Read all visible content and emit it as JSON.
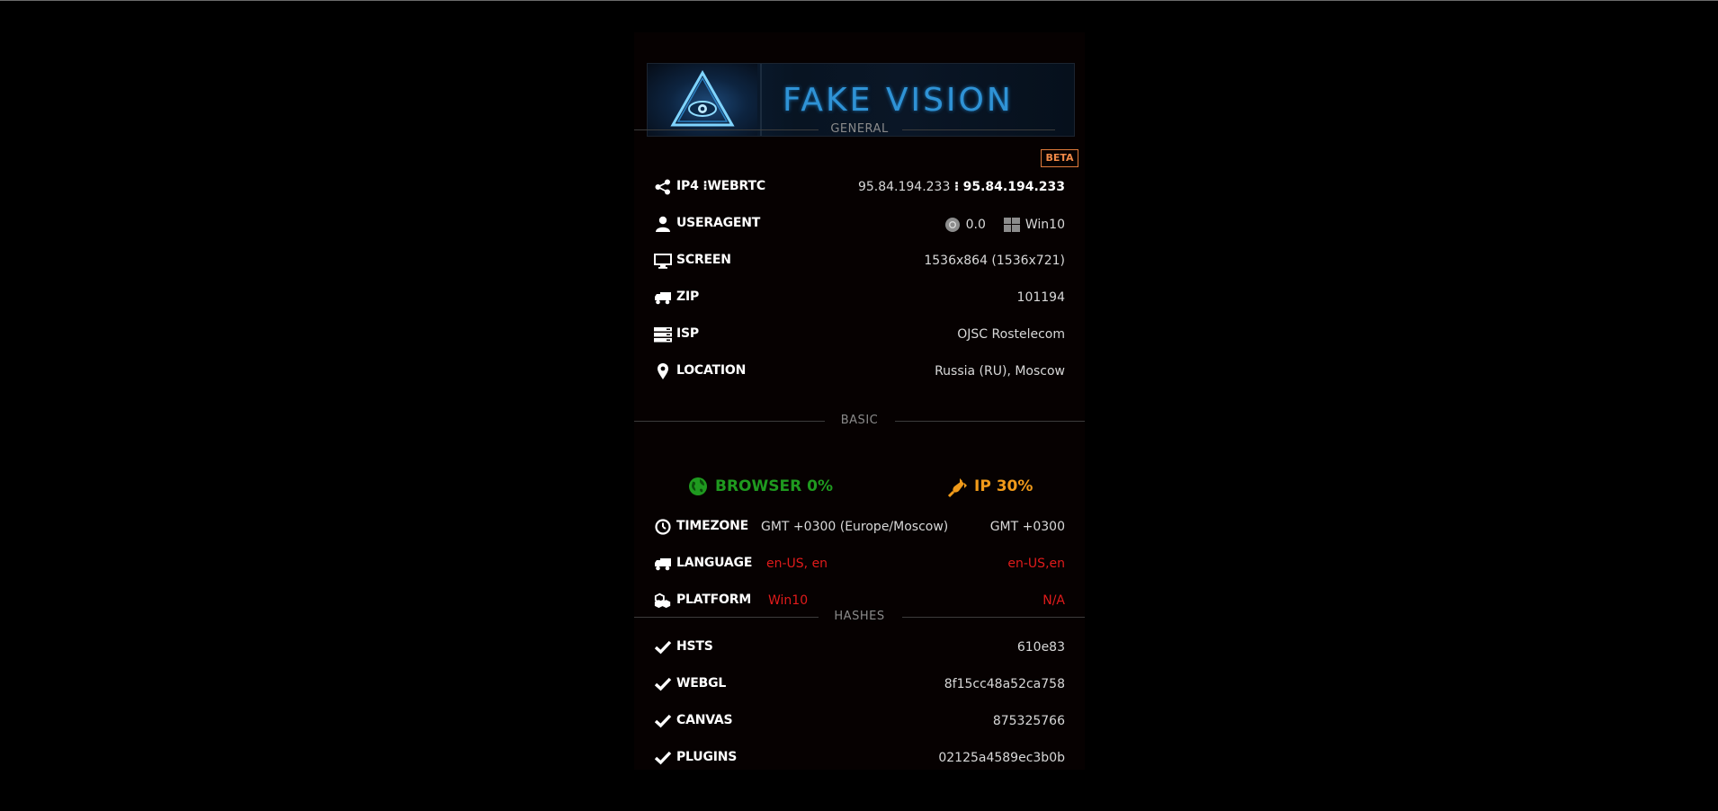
{
  "logo": {
    "text": "FAKE VISION"
  },
  "colors": {
    "background": "#000000",
    "panel": "#060101",
    "accent_blue": "#2f93d6",
    "beta_orange": "#f08a48",
    "browser_green": "#1f9a1f",
    "ip_orange": "#f09a1a",
    "mismatch_red": "#e01b1b"
  },
  "general": {
    "title": "GENERAL",
    "badge": "BETA",
    "rows": [
      {
        "icon": "share-icon",
        "label": "IP4",
        "label_sep": "⁝",
        "label2": "WEBRTC",
        "value": "95.84.194.233",
        "value_sep": "⁝",
        "value2": "95.84.194.233"
      },
      {
        "icon": "user-icon",
        "label": "USERAGENT",
        "browser_icon": "chrome-icon",
        "browser_version": "0.0",
        "os_icon": "windows-icon",
        "os": "Win10"
      },
      {
        "icon": "monitor-icon",
        "label": "SCREEN",
        "value": "1536x864 (1536x721)"
      },
      {
        "icon": "truck-icon",
        "label": "ZIP",
        "value": "101194"
      },
      {
        "icon": "server-icon",
        "label": "ISP",
        "value": "OJSC Rostelecom"
      },
      {
        "icon": "map-pin-icon",
        "label": "LOCATION",
        "value": "Russia (RU), Moscow"
      }
    ]
  },
  "basic": {
    "title": "BASIC",
    "browser_score": {
      "icon": "globe-icon",
      "label": "BROWSER 0%"
    },
    "ip_score": {
      "icon": "plug-icon",
      "label": "IP 30%"
    },
    "rows": [
      {
        "icon": "clock-icon",
        "label": "TIMEZONE",
        "browser_value": "GMT +0300 (Europe/Moscow)",
        "ip_value": "GMT +0300",
        "mismatch": false
      },
      {
        "icon": "truck-icon",
        "label": "LANGUAGE",
        "browser_value": "en-US, en",
        "ip_value": "en-US,en",
        "mismatch": true
      },
      {
        "icon": "cubes-icon",
        "label": "PLATFORM",
        "browser_value": "Win10",
        "ip_value": "N/A",
        "mismatch": true
      }
    ]
  },
  "hashes": {
    "title": "HASHES",
    "rows": [
      {
        "icon": "check-icon",
        "label": "HSTS",
        "value": "610e83"
      },
      {
        "icon": "check-icon",
        "label": "WEBGL",
        "value": "8f15cc48a52ca758"
      },
      {
        "icon": "check-icon",
        "label": "CANVAS",
        "value": "875325766"
      },
      {
        "icon": "check-icon",
        "label": "PLUGINS",
        "value": "02125a4589ec3b0b"
      }
    ]
  }
}
